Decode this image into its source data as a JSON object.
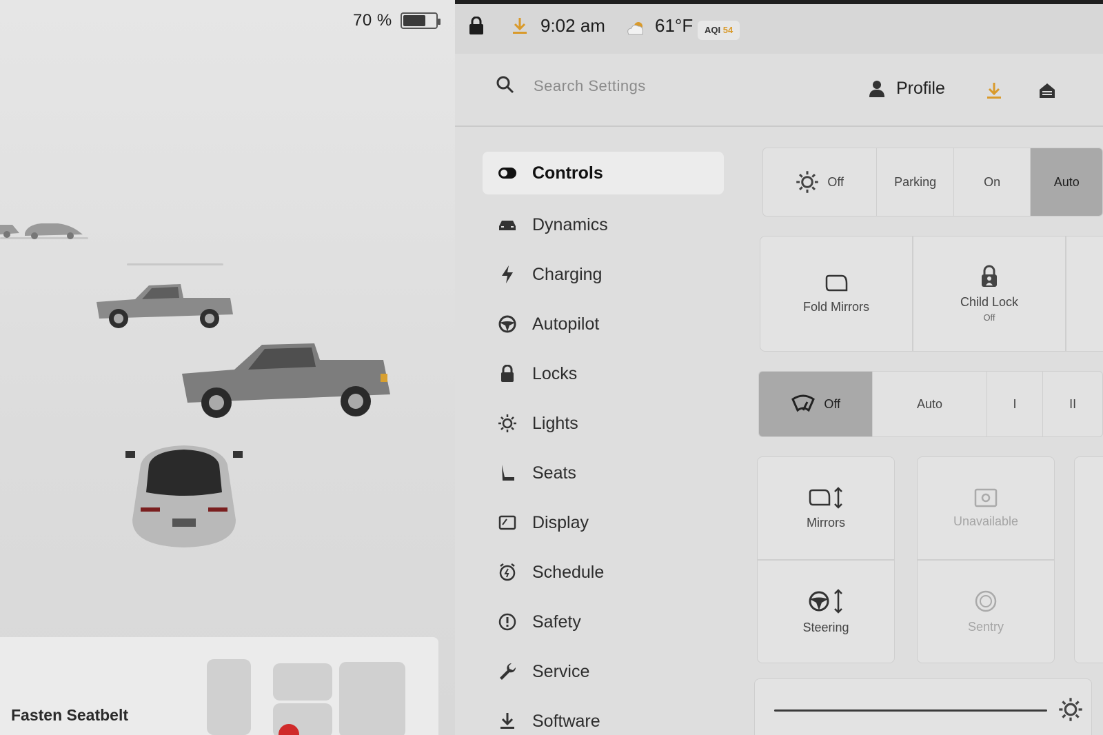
{
  "status": {
    "battery_percent": "70 %",
    "battery_level": 0.7,
    "time": "9:02 am",
    "temperature": "61°F",
    "aqi_label": "AQI",
    "aqi_value": "54"
  },
  "search": {
    "placeholder": "Search Settings"
  },
  "header": {
    "profile_label": "Profile"
  },
  "nav": {
    "items": [
      {
        "label": "Controls",
        "icon": "toggle-icon"
      },
      {
        "label": "Dynamics",
        "icon": "car-icon"
      },
      {
        "label": "Charging",
        "icon": "bolt-icon"
      },
      {
        "label": "Autopilot",
        "icon": "steering-wheel-icon"
      },
      {
        "label": "Locks",
        "icon": "lock-icon"
      },
      {
        "label": "Lights",
        "icon": "light-icon"
      },
      {
        "label": "Seats",
        "icon": "seat-icon"
      },
      {
        "label": "Display",
        "icon": "display-icon"
      },
      {
        "label": "Schedule",
        "icon": "schedule-icon"
      },
      {
        "label": "Safety",
        "icon": "safety-icon"
      },
      {
        "label": "Service",
        "icon": "wrench-icon"
      },
      {
        "label": "Software",
        "icon": "download-icon"
      }
    ],
    "active": "Controls"
  },
  "lights_control": {
    "off": "Off",
    "parking": "Parking",
    "on": "On",
    "auto": "Auto",
    "selected": "Auto"
  },
  "mirror_tiles": {
    "fold_mirrors": "Fold Mirrors",
    "child_lock": "Child Lock",
    "child_lock_state": "Off"
  },
  "wipers_control": {
    "off": "Off",
    "auto": "Auto",
    "level_1": "I",
    "level_2": "II",
    "selected": "Off"
  },
  "adjust_tiles": {
    "mirrors": "Mirrors",
    "unavailable": "Unavailable",
    "steering": "Steering",
    "sentry": "Sentry"
  },
  "seatbelt": {
    "message": "Fasten Seatbelt"
  },
  "colors": {
    "accent": "#d99a2b"
  }
}
